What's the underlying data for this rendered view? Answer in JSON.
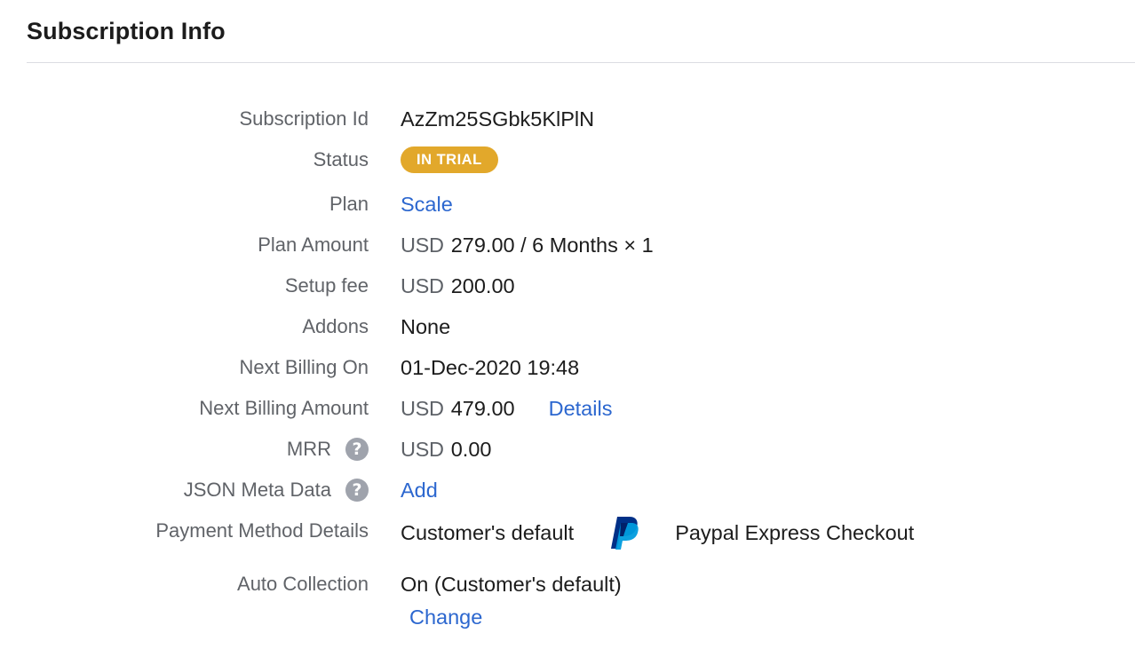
{
  "section": {
    "title": "Subscription Info"
  },
  "fields": {
    "subscription_id": {
      "label": "Subscription Id",
      "value": "AzZm25SGbk5KlPlN"
    },
    "status": {
      "label": "Status",
      "badge": "IN TRIAL",
      "badge_color": "#e2a82b"
    },
    "plan": {
      "label": "Plan",
      "link": "Scale"
    },
    "plan_amount": {
      "label": "Plan Amount",
      "currency": "USD",
      "value": "279.00 / 6 Months × 1"
    },
    "setup_fee": {
      "label": "Setup fee",
      "currency": "USD",
      "value": "200.00"
    },
    "addons": {
      "label": "Addons",
      "value": "None"
    },
    "next_billing_on": {
      "label": "Next Billing On",
      "value": "01-Dec-2020 19:48"
    },
    "next_billing_amount": {
      "label": "Next Billing Amount",
      "currency": "USD",
      "value": "479.00",
      "link": "Details"
    },
    "mrr": {
      "label": "MRR",
      "help_icon": "question-circle-icon",
      "help_glyph": "?",
      "currency": "USD",
      "value": "0.00"
    },
    "json_meta_data": {
      "label": "JSON Meta Data",
      "help_icon": "question-circle-icon",
      "help_glyph": "?",
      "link": "Add"
    },
    "payment_method": {
      "label": "Payment Method Details",
      "value": "Customer's default",
      "icon": "paypal-icon",
      "method": "Paypal Express Checkout"
    },
    "auto_collection": {
      "label": "Auto Collection",
      "value": "On (Customer's default)",
      "link": "Change"
    }
  },
  "colors": {
    "link": "#2c67cf",
    "label": "#606368",
    "value": "#1c1c1c",
    "help_icon_bg": "#9fa3ac",
    "paypal_dark": "#003087",
    "paypal_light": "#009cde",
    "divider": "#dcdde2"
  }
}
